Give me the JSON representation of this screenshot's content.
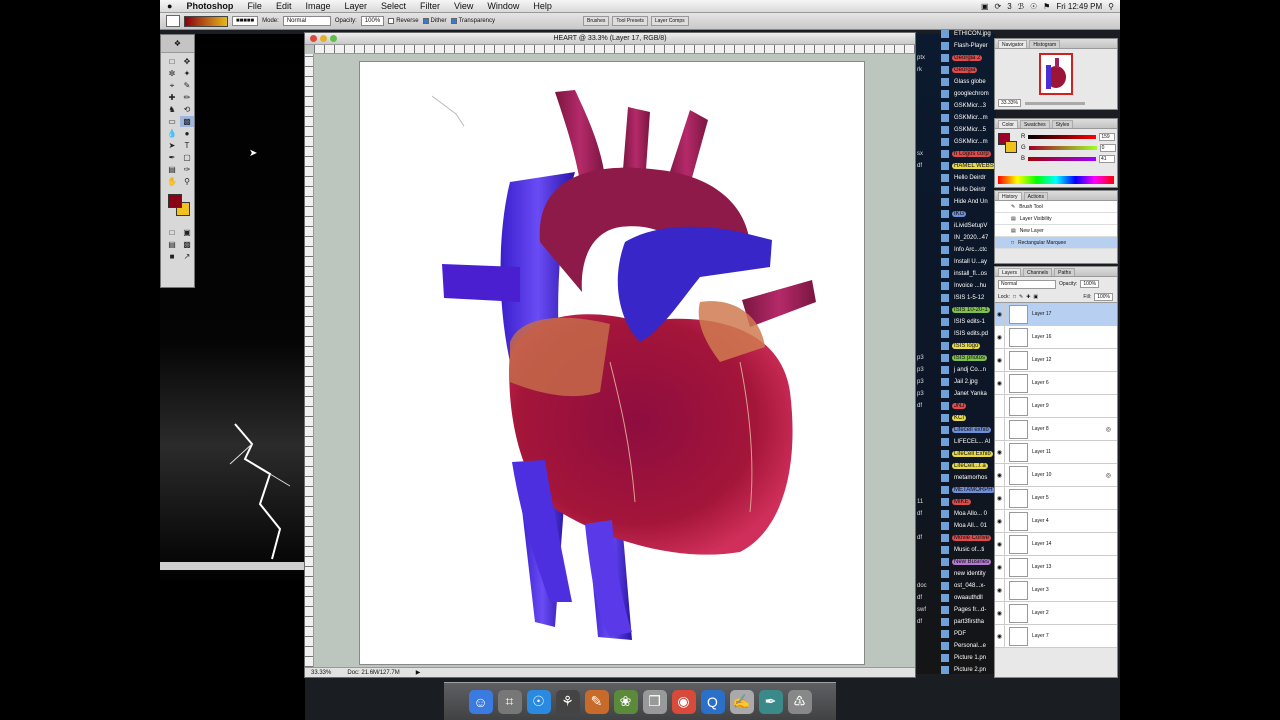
{
  "menubar": {
    "apple": "",
    "app": "Photoshop",
    "items": [
      "File",
      "Edit",
      "Image",
      "Layer",
      "Select",
      "Filter",
      "View",
      "Window",
      "Help"
    ],
    "status_3": "3",
    "clock": "Fri 12:49 PM"
  },
  "options": {
    "mode_label": "Mode:",
    "mode_value": "Normal",
    "opacity_label": "Opacity:",
    "opacity_value": "100%",
    "reverse": "Reverse",
    "dither": "Dither",
    "transparency": "Transparency",
    "wells": [
      "Brushes",
      "Tool Presets",
      "Layer Comps"
    ]
  },
  "document": {
    "title": "HEART @ 33.3% (Layer 17, RGB/8)",
    "zoom": "33.33%",
    "doc_info": "Doc: 21.6M/127.7M"
  },
  "navigator": {
    "tabs": [
      "Navigator",
      "Histogram"
    ],
    "zoom": "33.33%"
  },
  "color_panel": {
    "tabs": [
      "Color",
      "Swatches",
      "Styles"
    ],
    "channels": [
      {
        "name": "R",
        "value": "159"
      },
      {
        "name": "G",
        "value": "0"
      },
      {
        "name": "B",
        "value": "41"
      }
    ],
    "fg_color": "#9f0029",
    "bg_color": "#f1c21b"
  },
  "history": {
    "tabs": [
      "History",
      "Actions"
    ],
    "items": [
      "Brush Tool",
      "Layer Visibility",
      "New Layer",
      "Rectangular Marquee"
    ]
  },
  "layers_panel": {
    "tabs": [
      "Layers",
      "Channels",
      "Paths"
    ],
    "blend": "Normal",
    "opacity_label": "Opacity:",
    "opacity": "100%",
    "lock_label": "Lock:",
    "fill_label": "Fill:",
    "fill": "100%",
    "layers": [
      {
        "name": "Layer 17",
        "visible": true,
        "selected": true,
        "fx": false
      },
      {
        "name": "Layer 16",
        "visible": true,
        "selected": false,
        "fx": false
      },
      {
        "name": "Layer 12",
        "visible": true,
        "selected": false,
        "fx": false
      },
      {
        "name": "Layer 6",
        "visible": true,
        "selected": false,
        "fx": false
      },
      {
        "name": "Layer 9",
        "visible": false,
        "selected": false,
        "fx": false
      },
      {
        "name": "Layer 8",
        "visible": false,
        "selected": false,
        "fx": true
      },
      {
        "name": "Layer 11",
        "visible": true,
        "selected": false,
        "fx": false
      },
      {
        "name": "Layer 10",
        "visible": true,
        "selected": false,
        "fx": true
      },
      {
        "name": "Layer 5",
        "visible": true,
        "selected": false,
        "fx": false
      },
      {
        "name": "Layer 4",
        "visible": true,
        "selected": false,
        "fx": false
      },
      {
        "name": "Layer 14",
        "visible": true,
        "selected": false,
        "fx": false
      },
      {
        "name": "Layer 13",
        "visible": true,
        "selected": false,
        "fx": false
      },
      {
        "name": "Layer 3",
        "visible": true,
        "selected": false,
        "fx": false
      },
      {
        "name": "Layer 2",
        "visible": true,
        "selected": false,
        "fx": false
      },
      {
        "name": "Layer 7",
        "visible": true,
        "selected": false,
        "fx": false
      }
    ]
  },
  "desktop_files": [
    {
      "name": "ETHICON.jpg",
      "label": ""
    },
    {
      "name": "Flash-Player",
      "label": ""
    },
    {
      "name": "Georgia 2",
      "label": "#e04a4a"
    },
    {
      "name": "Georgia",
      "label": "#e04a4a"
    },
    {
      "name": "Glass globe",
      "label": ""
    },
    {
      "name": "googlechrom",
      "label": ""
    },
    {
      "name": "GSKMicr...3",
      "label": ""
    },
    {
      "name": "GSKMicr...m",
      "label": ""
    },
    {
      "name": "GSKMicr...5",
      "label": ""
    },
    {
      "name": "GSKMicr...m",
      "label": ""
    },
    {
      "name": "h Logos corp",
      "label": "#e04a4a"
    },
    {
      "name": "HAMEL WEBS",
      "label": "#e6d84a"
    },
    {
      "name": "Hello Deirdr",
      "label": ""
    },
    {
      "name": "Hello Deirdr",
      "label": ""
    },
    {
      "name": "Hide And Un",
      "label": ""
    },
    {
      "name": "IKG",
      "label": "#6f8fd8"
    },
    {
      "name": "iLividSetupV",
      "label": ""
    },
    {
      "name": "IN_2020...47",
      "label": ""
    },
    {
      "name": "Info Arc...ctc",
      "label": ""
    },
    {
      "name": "Install U...ay",
      "label": ""
    },
    {
      "name": "install_fl...os",
      "label": ""
    },
    {
      "name": "Invoice ...hu",
      "label": ""
    },
    {
      "name": "ISIS 1-5-12",
      "label": ""
    },
    {
      "name": "ISIS 10-20-1",
      "label": "#7fc04a"
    },
    {
      "name": "ISIS edits-1",
      "label": ""
    },
    {
      "name": "ISIS edits.pd",
      "label": ""
    },
    {
      "name": "ISIS logo",
      "label": "#e6d84a"
    },
    {
      "name": "ISIS photos",
      "label": "#7fc04a"
    },
    {
      "name": "j andj Co...n",
      "label": ""
    },
    {
      "name": "Jail 2.jpg",
      "label": ""
    },
    {
      "name": "Janet Yanka",
      "label": ""
    },
    {
      "name": "JNJ",
      "label": "#e04a4a"
    },
    {
      "name": "KCI",
      "label": "#e6d84a"
    },
    {
      "name": "Lifecell exhib",
      "label": "#6f8fd8"
    },
    {
      "name": "LIFECEL... Al",
      "label": ""
    },
    {
      "name": "LifeCell Exhib",
      "label": "#e6d84a"
    },
    {
      "name": "LifeCell...t a",
      "label": "#e6d84a"
    },
    {
      "name": "metamorhos",
      "label": ""
    },
    {
      "name": "METAMORPH",
      "label": "#6f8fd8"
    },
    {
      "name": "MIKE",
      "label": "#e04a4a"
    },
    {
      "name": "Moa Allo... 0",
      "label": ""
    },
    {
      "name": "Moa All... 01",
      "label": ""
    },
    {
      "name": "Movie Conve",
      "label": "#e04a4a"
    },
    {
      "name": "Music of...ti",
      "label": ""
    },
    {
      "name": "New Busines",
      "label": "#b07ad0"
    },
    {
      "name": "new identity",
      "label": ""
    },
    {
      "name": "ost_048...x-",
      "label": ""
    },
    {
      "name": "owaauthdll",
      "label": ""
    },
    {
      "name": "Pages fr...d-",
      "label": ""
    },
    {
      "name": "part3firstha",
      "label": ""
    },
    {
      "name": "PDF",
      "label": ""
    },
    {
      "name": "Personal...e",
      "label": ""
    },
    {
      "name": "Picture 1.pn",
      "label": ""
    },
    {
      "name": "Picture 2.pn",
      "label": ""
    }
  ],
  "desktop_ext": [
    "ptx",
    "rk",
    "",
    "",
    "",
    "",
    "",
    "",
    "sx",
    "df",
    "",
    "",
    "",
    "",
    "",
    "",
    "",
    "",
    "",
    "",
    "",
    "",
    "",
    "",
    "",
    "p3",
    "p3",
    "p3",
    "p3",
    "df",
    "",
    "",
    "",
    "",
    "",
    "",
    "",
    "11",
    "df",
    "",
    "df",
    "",
    "",
    "",
    "doc",
    "df",
    "swf",
    "df",
    "",
    "",
    ""
  ],
  "dock_items": [
    "finder-icon",
    "calculator-icon",
    "safari-icon",
    "clapper-icon",
    "brush-icon",
    "photos-icon",
    "preview-icon",
    "chrome-icon",
    "quicktime-icon",
    "textedit-icon",
    "feather-icon",
    "trash-icon"
  ]
}
